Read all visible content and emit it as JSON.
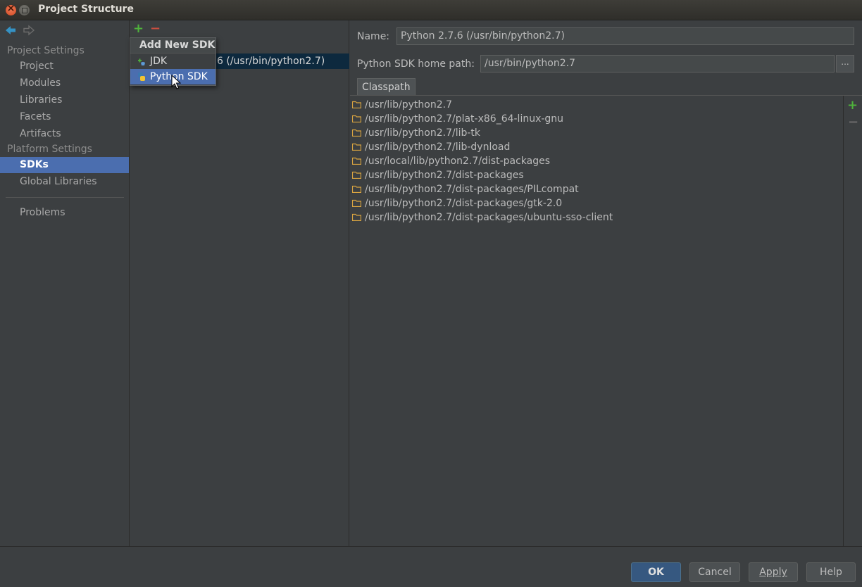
{
  "window": {
    "title": "Project Structure"
  },
  "sidebar": {
    "project_settings_header": "Project Settings",
    "project_items": [
      {
        "label": "Project"
      },
      {
        "label": "Modules"
      },
      {
        "label": "Libraries"
      },
      {
        "label": "Facets"
      },
      {
        "label": "Artifacts"
      }
    ],
    "platform_settings_header": "Platform Settings",
    "platform_items": [
      {
        "label": "SDKs",
        "selected": true
      },
      {
        "label": "Global Libraries"
      }
    ],
    "problems_label": "Problems"
  },
  "sdk_list": {
    "add_symbol": "+",
    "remove_symbol": "−",
    "selected_sdk_visible_text": "6 (/usr/bin/python2.7)"
  },
  "popup": {
    "title": "Add New SDK",
    "items": [
      {
        "label": "JDK",
        "icon": "jdk-icon"
      },
      {
        "label": "Python SDK",
        "icon": "python-icon",
        "selected": true
      }
    ]
  },
  "details": {
    "name_label": "Name:",
    "name_value": "Python 2.7.6 (/usr/bin/python2.7)",
    "home_path_label": "Python SDK home path:",
    "home_path_value": "/usr/bin/python2.7",
    "browse_label": "...",
    "tab_label": "Classpath",
    "classpath": [
      "/usr/lib/python2.7",
      "/usr/lib/python2.7/plat-x86_64-linux-gnu",
      "/usr/lib/python2.7/lib-tk",
      "/usr/lib/python2.7/lib-dynload",
      "/usr/local/lib/python2.7/dist-packages",
      "/usr/lib/python2.7/dist-packages",
      "/usr/lib/python2.7/dist-packages/PILcompat",
      "/usr/lib/python2.7/dist-packages/gtk-2.0",
      "/usr/lib/python2.7/dist-packages/ubuntu-sso-client"
    ],
    "add_symbol": "+",
    "remove_symbol": "−"
  },
  "buttons": {
    "ok": "OK",
    "cancel": "Cancel",
    "apply": "Apply",
    "help": "Help"
  },
  "colors": {
    "background": "#3c3f41",
    "selection": "#4b6eaf",
    "add_green": "#4fb33c",
    "remove_red": "#c84e40",
    "folder": "#d9a441"
  }
}
